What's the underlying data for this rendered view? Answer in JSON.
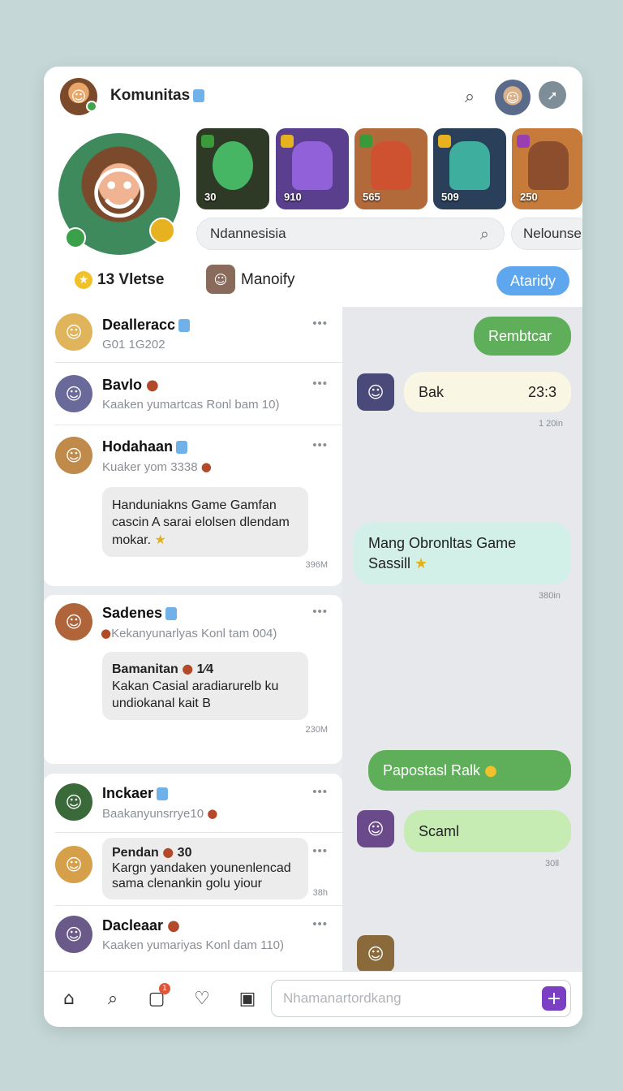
{
  "header": {
    "title": "Komunitas",
    "search_icon": "search-icon",
    "action_icon": "arrow-icon",
    "profile_stat": "13 Vletse",
    "profile_tag": "Manoify",
    "pill_label": "Ataridy",
    "search_placeholder": "Ndannesisia",
    "search2_text": "Nelounse"
  },
  "games": [
    {
      "score": "30",
      "color": "#2e3a26",
      "accent": "#4fe07a"
    },
    {
      "score": "910",
      "color": "#5a3f8e",
      "accent": "#a36ef0"
    },
    {
      "score": "565",
      "color": "#b36a3a",
      "accent": "#d84b2d"
    },
    {
      "score": "509",
      "color": "#2a3f5a",
      "accent": "#46d6b5"
    },
    {
      "score": "250",
      "color": "#c77b3a",
      "accent": "#7a3f2a"
    }
  ],
  "posts": [
    {
      "name": "Dealleracc",
      "sub": "G01 1G202",
      "more": "•••"
    },
    {
      "name": "Bavlo",
      "sub": "Kaaken yumartcas Ronl bam 10)",
      "more": "•••"
    },
    {
      "name": "Hodahaan",
      "sub": "Kuaker yom 3338",
      "more": "•••",
      "bubble": "Handuniakns Game Gamfan cascin A sarai elolsen dlendam mokar.",
      "time": "396M"
    },
    {
      "name": "Sadenes",
      "sub": "Kekanyunarlyas Konl tam 004)",
      "more": "•••",
      "bubble_title": "Bamanitan",
      "bubble_mark": "1⁄4",
      "bubble": "Kakan Casial aradiarurelb ku undiokanal kait B",
      "time": "230M"
    },
    {
      "name": "Inckaer",
      "sub": "Baakanyunsrrye10",
      "more": "•••"
    },
    {
      "name": "Pendan",
      "sub_num": "30",
      "bubble": "Kargn yandaken younenlencad sama clenankin golu yiour",
      "more": "•••",
      "time": "38h"
    },
    {
      "name": "Dacleaar",
      "sub": "Kaaken yumariyas Konl dam 110)",
      "more": "•••"
    }
  ],
  "chat": [
    {
      "text": "Rembtcar",
      "side": "out"
    },
    {
      "text": "Bak",
      "extra": "23:3",
      "side": "in",
      "time": "1 20in"
    },
    {
      "text": "Mang Obronltas Game Sassill",
      "side": "out",
      "time": "380in"
    },
    {
      "text": "Papostasl Ralk",
      "side": "out"
    },
    {
      "text": "Scaml",
      "side": "in",
      "time": "30ll"
    }
  ],
  "bottom": {
    "nav": [
      "home-icon",
      "search-icon",
      "chat-icon",
      "heart-icon",
      "image-icon"
    ],
    "nav_badge": "1",
    "input_placeholder": "Nhamanartordkang",
    "plus_label": "+"
  },
  "colors": {
    "accent_blue": "#5ea7ef",
    "green_bubble": "#5fae5a",
    "mint_bubble": "#d2efe8",
    "light_green": "#c6ecb4",
    "purple": "#7b3fc4"
  }
}
